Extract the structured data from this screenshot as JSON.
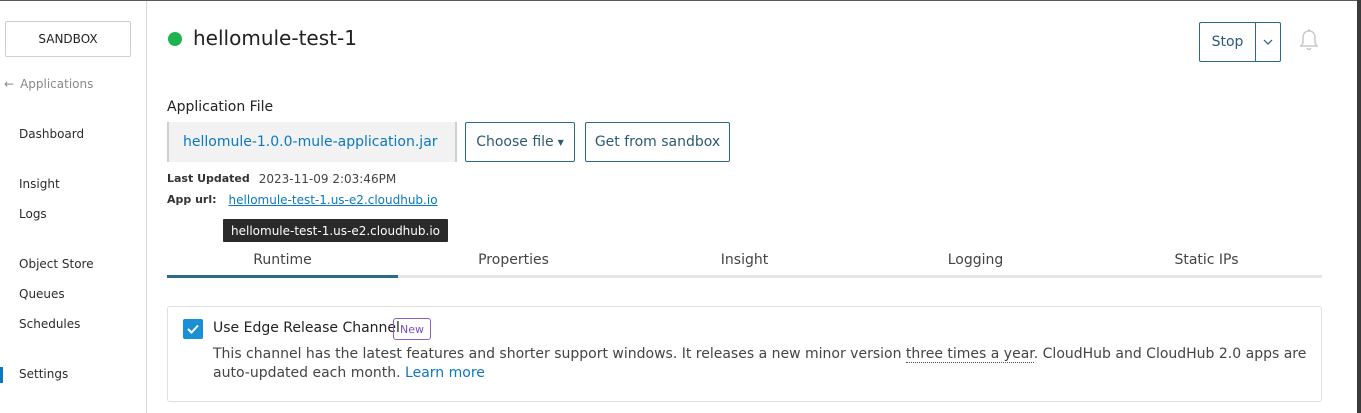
{
  "sidebar": {
    "environment": "SANDBOX",
    "back_label": "Applications",
    "items": [
      {
        "label": "Dashboard"
      },
      {
        "label": "Insight"
      },
      {
        "label": "Logs"
      },
      {
        "label": "Object Store"
      },
      {
        "label": "Queues"
      },
      {
        "label": "Schedules"
      },
      {
        "label": "Settings"
      }
    ],
    "active_item": "Settings"
  },
  "header": {
    "app_name": "hellomule-test-1",
    "status_color": "#1eb350",
    "stop_label": "Stop"
  },
  "app_file": {
    "section_label": "Application File",
    "file_name": "hellomule-1.0.0-mule-application.jar",
    "choose_file_label": "Choose file",
    "sandbox_label": "Get from sandbox",
    "last_updated_key": "Last Updated",
    "last_updated_value": "2023-11-09 2:03:46PM",
    "app_url_key": "App url:",
    "app_url_value": "hellomule-test-1.us-e2.cloudhub.io",
    "tooltip": "hellomule-test-1.us-e2.cloudhub.io"
  },
  "tabs": [
    {
      "label": "Runtime",
      "active": true
    },
    {
      "label": "Properties"
    },
    {
      "label": "Insight"
    },
    {
      "label": "Logging"
    },
    {
      "label": "Static IPs"
    }
  ],
  "edge_channel": {
    "checked": true,
    "title": "Use Edge Release Channel",
    "badge": "New",
    "desc_part1": "This channel has the latest features and shorter support windows. It releases a new minor version ",
    "desc_dotted": "three times a year",
    "desc_part2": ". CloudHub and CloudHub 2.0 apps are auto-updated each month. ",
    "learn_more": "Learn more"
  },
  "colors": {
    "accent": "#0a79bf",
    "button_border": "#2c6a8c",
    "badge": "#8c5fd1"
  }
}
